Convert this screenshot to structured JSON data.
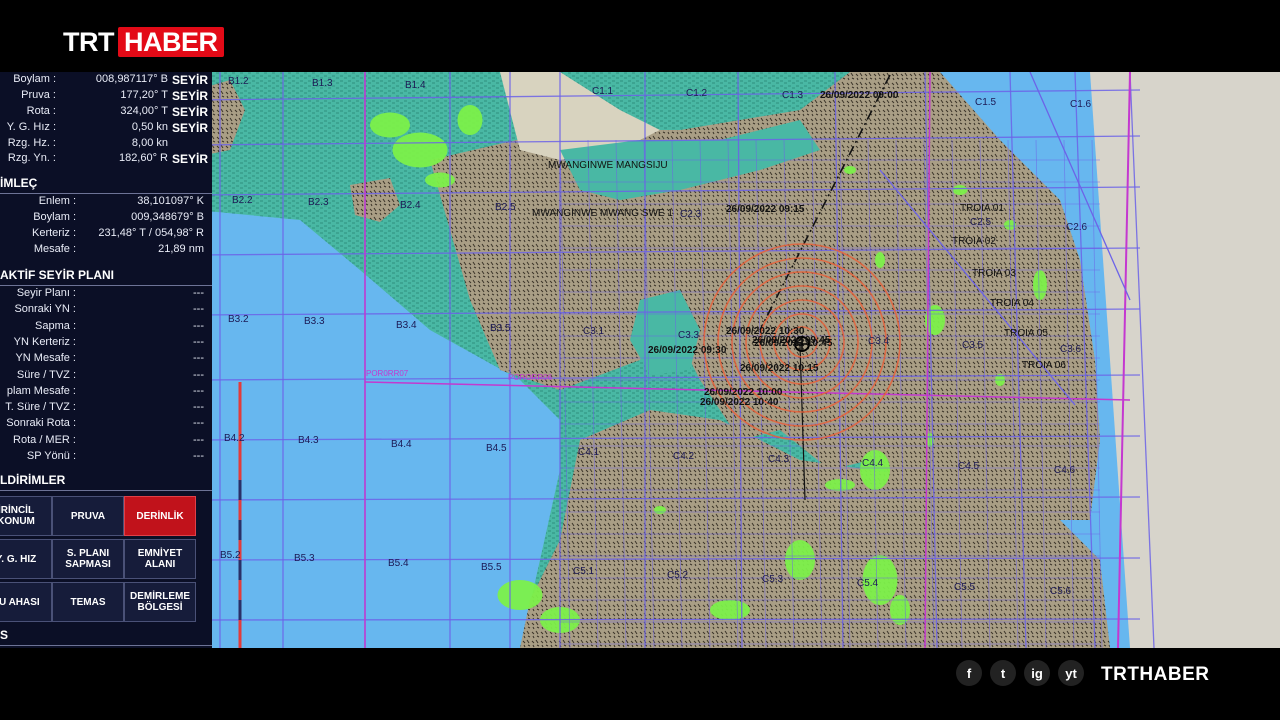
{
  "logo": {
    "trt": "TRT",
    "haber": "HABER"
  },
  "footer": {
    "brand": "TRTHABER",
    "socials": [
      "f",
      "t",
      "ig",
      "yt"
    ]
  },
  "nav_panel": {
    "nav_rows": [
      {
        "label": "Boylam :",
        "value": "008,987117° B",
        "mode": "SEYİR"
      },
      {
        "label": "Pruva :",
        "value": "177,20° T",
        "mode": "SEYİR"
      },
      {
        "label": "Rota :",
        "value": "324,00° T",
        "mode": "SEYİR"
      },
      {
        "label": "Y. G. Hız :",
        "value": "0,50 kn",
        "mode": "SEYİR"
      },
      {
        "label": "Rzg. Hz. :",
        "value": "8,00 kn",
        "mode": ""
      },
      {
        "label": "Rzg. Yn. :",
        "value": "182,60° R",
        "mode": "SEYİR"
      }
    ],
    "cursor_title": "İMLEÇ",
    "cursor_rows": [
      {
        "label": "Enlem :",
        "value": "38,101097° K"
      },
      {
        "label": "Boylam :",
        "value": "009,348679° B"
      },
      {
        "label": "Kerteriz :",
        "value": "231,48° T / 054,98° R"
      },
      {
        "label": "Mesafe :",
        "value": "21,89 nm"
      }
    ],
    "plan_title": "AKTİF SEYİR PLANI",
    "plan_rows": [
      {
        "label": "Seyir Planı :",
        "value": "---"
      },
      {
        "label": "Sonraki YN :",
        "value": "---"
      },
      {
        "label": "Sapma :",
        "value": "---"
      },
      {
        "label": "YN Kerteriz :",
        "value": "---"
      },
      {
        "label": "YN Mesafe :",
        "value": "---"
      },
      {
        "label": "Süre / TVZ :",
        "value": "---"
      },
      {
        "label": "plam Mesafe :",
        "value": "---"
      },
      {
        "label": "T. Süre / TVZ :",
        "value": "---"
      },
      {
        "label": "Sonraki Rota :",
        "value": "---"
      },
      {
        "label": "Rota / MER :",
        "value": "---"
      },
      {
        "label": "SP Yönü :",
        "value": "---"
      }
    ],
    "alarm_title": "LDİRİMLER",
    "alarm_buttons": [
      {
        "label": "İRİNCİL KONUM",
        "active": false
      },
      {
        "label": "PRUVA",
        "active": false
      },
      {
        "label": "DERİNLİK",
        "active": true
      },
      {
        "label": "Y. G. HIZ",
        "active": false
      },
      {
        "label": "S. PLANI SAPMASI",
        "active": false
      },
      {
        "label": "EMNİYET ALANI",
        "active": false
      },
      {
        "label": "SU AHASI",
        "active": false
      },
      {
        "label": "TEMAS",
        "active": false
      },
      {
        "label": "DEMİRLEME BÖLGESİ",
        "active": false
      }
    ],
    "bottom_title": "S"
  },
  "map": {
    "colors": {
      "sea": "#67b7ef",
      "shallow": "#49b8a4",
      "land": "#a99e85",
      "vegetation": "#7cf04a",
      "grid": "#6c63e8",
      "boundary": "#c438d0",
      "rings": "#e8623b"
    },
    "grid_labels": [
      "B1.2",
      "B1.3",
      "B1.4",
      "C1.1",
      "C1.2",
      "C1.3",
      "C1.5",
      "C1.6",
      "B2.2",
      "B2.3",
      "B2.4",
      "B2.5",
      "C2.3",
      "C2.5",
      "C2.6",
      "B3.2",
      "B3.3",
      "B3.4",
      "B3.5",
      "C3.1",
      "C3.3",
      "C3.4",
      "C3.5",
      "C3.6",
      "B4.2",
      "B4.3",
      "B4.4",
      "B4.5",
      "C4.1",
      "C4.2",
      "C4.3",
      "C4.4",
      "C4.5",
      "C4.6",
      "B5.2",
      "B5.3",
      "B5.4",
      "B5.5",
      "C5.1",
      "C5.2",
      "C5.3",
      "C5.4",
      "C5.5",
      "C5.6"
    ],
    "place_labels": [
      "MWANGINWE MANGSIJU",
      "MWANGINWE MWANG SWE 1",
      "TROIA 01",
      "TROIA 02",
      "TROIA 03",
      "TROIA 04",
      "TROIA 05",
      "TROIA 06",
      "POR0RR07",
      "PORORR06"
    ],
    "track_labels": [
      "26/09/2022 09:00",
      "26/09/2022 09:15",
      "26/09/2022 09:30",
      "26/09/2022 09:45",
      "26/09/2022 10:00",
      "26/09/2022 10:15",
      "26/09/2022 10:30",
      "26/09/2022 10:40",
      "26/09/2022 10:45"
    ]
  }
}
